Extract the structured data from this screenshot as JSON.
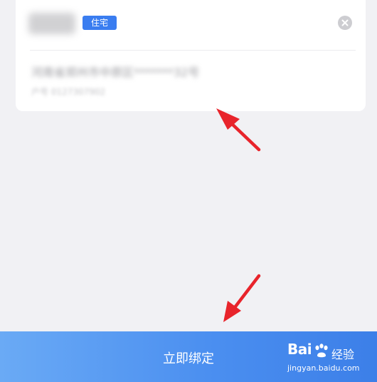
{
  "card": {
    "tag_label": "住宅",
    "address_line": "河南省郑州市中原区*******32号",
    "account_line": "户号 0127307902"
  },
  "footer": {
    "bind_button_label": "立即绑定"
  },
  "watermark": {
    "brand_prefix": "Bai",
    "brand_suffix": "经验",
    "url": "jingyan.baidu.com"
  },
  "colors": {
    "tag_bg": "#3a7df0",
    "button_gradient_start": "#6aaaf5",
    "button_gradient_end": "#3c7fe8",
    "arrow": "#e8242b",
    "background": "#f1f1f4"
  }
}
